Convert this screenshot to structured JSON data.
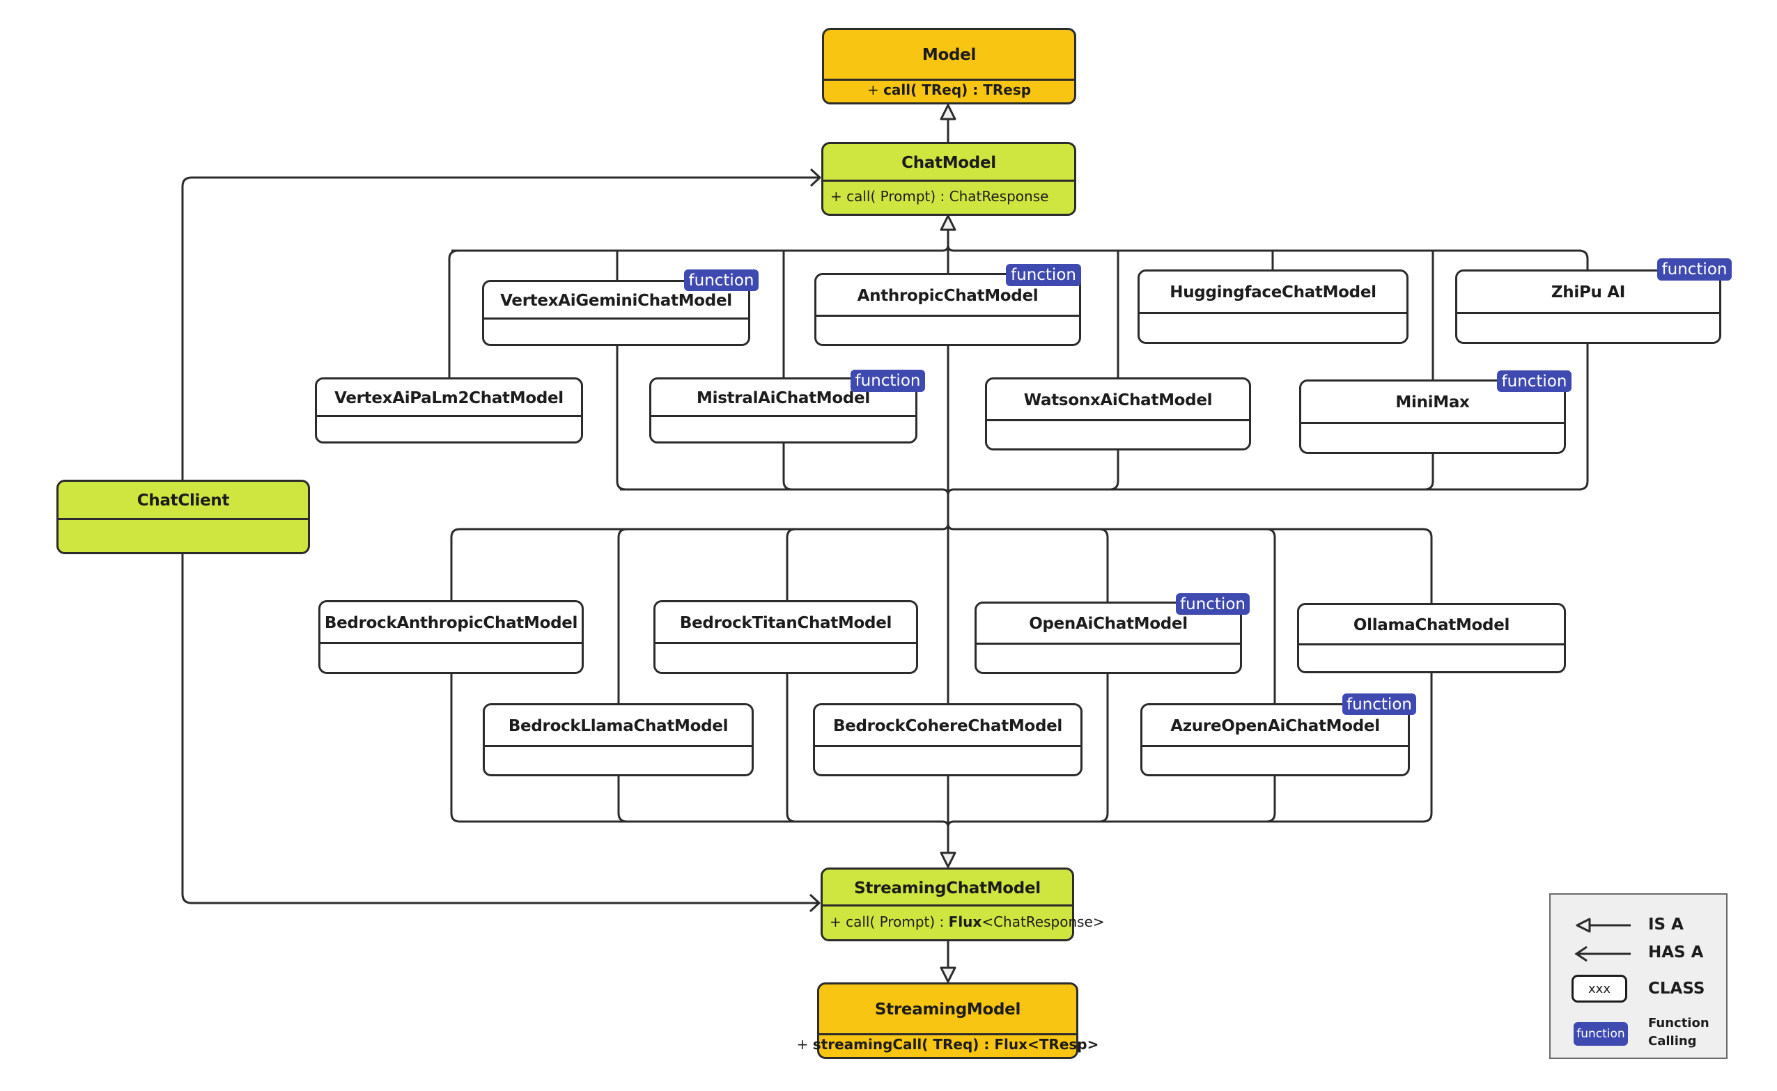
{
  "diagram": {
    "colors": {
      "base_interface": "#f8c513",
      "chat_interface": "#cfe640",
      "implementation": "#ffffff",
      "function_badge": "#3f4ab0",
      "line": "#2b2b2b"
    },
    "interfaces": {
      "model": {
        "name": "Model",
        "member_prefix": "+ ",
        "member_method": "call",
        "member_args": "( TReq) : ",
        "member_return": "TResp"
      },
      "chat_model": {
        "name": "ChatModel",
        "member": "+ call( Prompt) : ChatResponse"
      },
      "chat_client": {
        "name": "ChatClient"
      },
      "streaming_chat_model": {
        "name": "StreamingChatModel",
        "member_prefix": "+ call( Prompt) : ",
        "member_flux": "Flux",
        "member_suffix": "<ChatResponse>"
      },
      "streaming_model": {
        "name": "StreamingModel",
        "member_prefix": "+ ",
        "member_method": "streamingCall",
        "member_args": "( TReq) : ",
        "member_return": "Flux<TResp>"
      }
    },
    "badge_label": "function",
    "implementations": [
      {
        "name": "VertexAiGeminiChatModel",
        "function_calling": true
      },
      {
        "name": "VertexAiPaLm2ChatModel",
        "function_calling": false
      },
      {
        "name": "AnthropicChatModel",
        "function_calling": true
      },
      {
        "name": "MistralAiChatModel",
        "function_calling": true
      },
      {
        "name": "HuggingfaceChatModel",
        "function_calling": false
      },
      {
        "name": "WatsonxAiChatModel",
        "function_calling": false
      },
      {
        "name": "ZhiPu AI",
        "function_calling": true
      },
      {
        "name": "MiniMax",
        "function_calling": true
      },
      {
        "name": "BedrockAnthropicChatModel",
        "function_calling": false
      },
      {
        "name": "BedrockLlamaChatModel",
        "function_calling": false
      },
      {
        "name": "BedrockTitanChatModel",
        "function_calling": false
      },
      {
        "name": "BedrockCohereChatModel",
        "function_calling": false
      },
      {
        "name": "OpenAiChatModel",
        "function_calling": true
      },
      {
        "name": "AzureOpenAiChatModel",
        "function_calling": true
      },
      {
        "name": "OllamaChatModel",
        "function_calling": false
      }
    ],
    "legend": {
      "is_a": "IS A",
      "has_a": "HAS A",
      "class_sample": "xxx",
      "class": "CLASS",
      "badge_sample": "function",
      "function_calling_line1": "Function",
      "function_calling_line2": "Calling"
    }
  }
}
